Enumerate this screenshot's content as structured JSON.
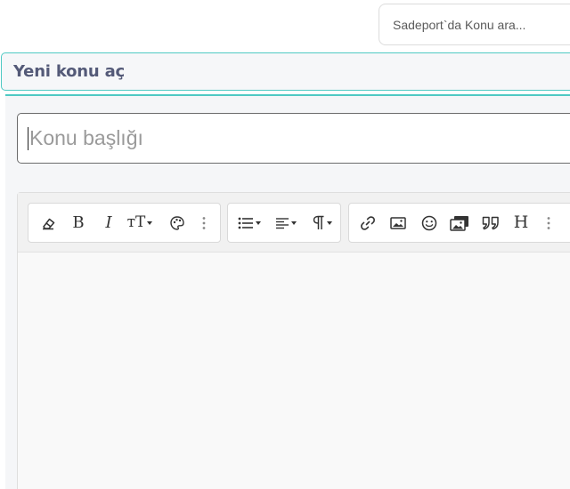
{
  "search": {
    "placeholder": "Sadeport`da Konu ara..."
  },
  "page": {
    "title": "Yeni konu aç"
  },
  "form": {
    "subject_placeholder": "Konu başlığı"
  },
  "toolbar": {
    "groups": [
      {
        "name": "text",
        "buttons": [
          "remove-format",
          "bold",
          "italic",
          "text-size",
          "text-color",
          "more-text"
        ]
      },
      {
        "name": "paragraph",
        "buttons": [
          "list",
          "align",
          "paragraph-format"
        ]
      },
      {
        "name": "insert",
        "buttons": [
          "link",
          "image",
          "smilie",
          "media-gallery",
          "quote",
          "heading",
          "more-insert"
        ]
      }
    ],
    "bold_label": "B",
    "italic_label": "I",
    "heading_label": "H",
    "text_size_label": "тT"
  },
  "colors": {
    "accent": "#4fc9c3",
    "title": "#545a78"
  }
}
